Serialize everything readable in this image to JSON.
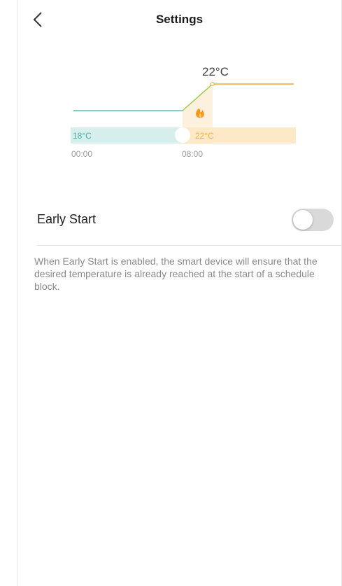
{
  "nav": {
    "title": "Settings",
    "back_icon": "chevron-left-icon"
  },
  "illustration": {
    "target_temp": "22°C",
    "low_temp": "18°C",
    "high_temp": "22°C",
    "time_start": "00:00",
    "time_switch": "08:00",
    "heat_icon": "flame-icon",
    "colors": {
      "cool_line": "#5bbfae",
      "cool_band": "#d6efec",
      "cool_text": "#4fb3a4",
      "warm_line": "#f0a830",
      "warm_band": "#fde9c8",
      "warm_text": "#f3b04a",
      "ramp_fill": "#fdf1de"
    }
  },
  "early_start": {
    "label": "Early Start",
    "enabled": false,
    "description": "When Early Start is enabled, the smart device will ensure that the desired temperature is already reached at the start of a schedule block."
  }
}
